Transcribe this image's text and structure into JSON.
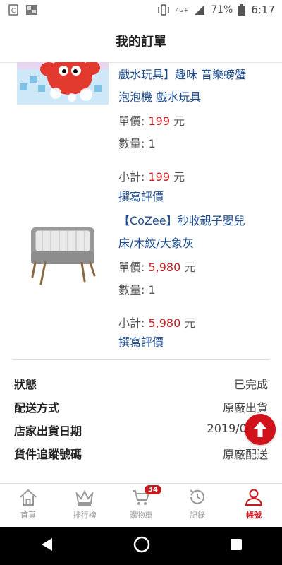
{
  "status_bar": {
    "network": "4G+",
    "battery": "71%",
    "time": "6:17"
  },
  "header": {
    "title": "我的訂單"
  },
  "items": [
    {
      "title_line1": "戲水玩具】趣味 音樂螃蟹",
      "title_line2": "泡泡機 戲水玩具",
      "unit_price_label": "單價: ",
      "unit_price": "199",
      "currency": " 元",
      "qty_label": "數量: ",
      "qty": "1",
      "subtotal_label": "小計: ",
      "subtotal": "199",
      "review": "撰寫評價"
    },
    {
      "title_line1": "【CoZee】秒收親子嬰兒",
      "title_line2": "床/木紋/大象灰",
      "unit_price_label": "單價: ",
      "unit_price": "5,980",
      "currency": " 元",
      "qty_label": "數量: ",
      "qty": "1",
      "subtotal_label": "小計: ",
      "subtotal": "5,980",
      "review": "撰寫評價"
    }
  ],
  "order_info": [
    {
      "label": "狀態",
      "value": "已完成"
    },
    {
      "label": "配送方式",
      "value": "原廠出貨"
    },
    {
      "label": "店家出貨日期",
      "value": "2019/06"
    },
    {
      "label": "貨件追蹤號碼",
      "value": "原廠配送"
    }
  ],
  "tabs": [
    {
      "label": "首頁",
      "icon": "home-icon"
    },
    {
      "label": "排行榜",
      "icon": "crown-icon"
    },
    {
      "label": "購物車",
      "icon": "cart-icon",
      "badge": "34"
    },
    {
      "label": "記錄",
      "icon": "history-icon"
    },
    {
      "label": "帳號",
      "icon": "person-icon"
    }
  ],
  "colors": {
    "accent": "#c8191f",
    "link": "#1c4c8f"
  }
}
